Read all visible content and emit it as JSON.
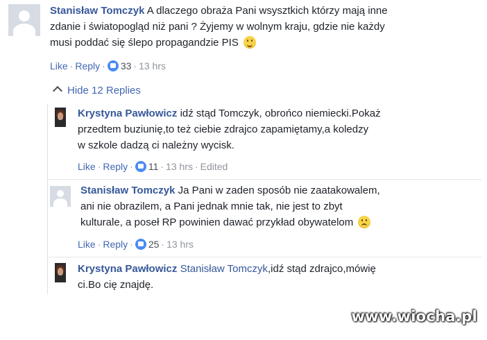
{
  "comments": [
    {
      "author": "Stanisław Tomczyk",
      "lines": [
        "A dlaczego obraża Pani wsysztkich którzy mają inne",
        "zdanie i światopogląd niż pani ? Żyjemy w wolnym kraju, gdzie nie każdy",
        "musi poddać się ślepo propagandzie PIS"
      ],
      "emoji": "smile-emoji",
      "actions": {
        "like": "Like",
        "reply": "Reply",
        "likes": "33",
        "time": "13 hrs"
      }
    }
  ],
  "hide_replies": "Hide 12 Replies",
  "replies": [
    {
      "author": "Krystyna Pawłowicz",
      "lines": [
        "idź stąd Tomczyk, obrońco niemiecki.Pokaż",
        "przedtem buziunię,to też ciebie zdrajco zapamiętamy,a koledzy",
        "w szkole dadzą ci należny wycisk."
      ],
      "actions": {
        "like": "Like",
        "reply": "Reply",
        "likes": "11",
        "time": "13 hrs",
        "edited": "Edited"
      }
    },
    {
      "author": "Stanisław Tomczyk",
      "lines": [
        "Ja Pani w zaden sposób nie zaatakowalem,",
        "ani nie obrazilem, a Pani jednak mnie tak, nie jest to zbyt",
        "kulturale, a poseł RP powinien dawać przykład obywatelom"
      ],
      "emoji": "sad-emoji",
      "actions": {
        "like": "Like",
        "reply": "Reply",
        "likes": "25",
        "time": "13 hrs"
      }
    },
    {
      "author": "Krystyna Pawłowicz",
      "mention": "Stanisław Tomczyk",
      "lines": [
        ",idź stąd zdrajco,mówię",
        "ci.Bo cię znajdę."
      ]
    }
  ],
  "separator": "·",
  "watermark": "www.wiocha.pl"
}
